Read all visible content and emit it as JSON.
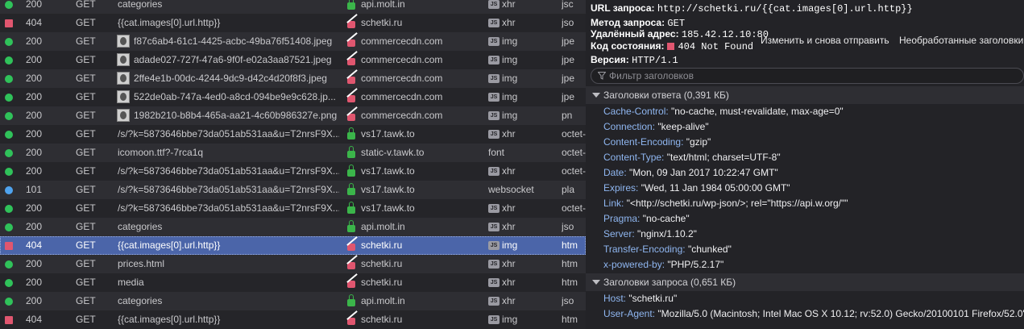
{
  "requests": [
    {
      "status": "200",
      "dot": "ok",
      "method": "GET",
      "file": "categories",
      "thumb": false,
      "domain": "api.molt.in",
      "secure": "lock",
      "js": true,
      "cause": "xhr",
      "type": "jsc"
    },
    {
      "status": "404",
      "dot": "err",
      "method": "GET",
      "file": "{{cat.images[0].url.http}}",
      "thumb": false,
      "domain": "schetki.ru",
      "secure": "insecure",
      "js": true,
      "cause": "xhr",
      "type": "jso"
    },
    {
      "status": "200",
      "dot": "ok",
      "method": "GET",
      "file": "f87c6ab4-61c1-4425-acbc-49ba76f51408.jpeg",
      "thumb": true,
      "domain": "commercecdn.com",
      "secure": "insecure",
      "js": true,
      "cause": "img",
      "type": "jpe"
    },
    {
      "status": "200",
      "dot": "ok",
      "method": "GET",
      "file": "adade027-727f-47a6-9f0f-e02a3aa87521.jpeg",
      "thumb": true,
      "domain": "commercecdn.com",
      "secure": "insecure",
      "js": true,
      "cause": "img",
      "type": "jpe"
    },
    {
      "status": "200",
      "dot": "ok",
      "method": "GET",
      "file": "2ffe4e1b-00dc-4244-9dc9-d42c4d20f8f3.jpeg",
      "thumb": true,
      "domain": "commercecdn.com",
      "secure": "insecure",
      "js": true,
      "cause": "img",
      "type": "jpe"
    },
    {
      "status": "200",
      "dot": "ok",
      "method": "GET",
      "file": "522de0ab-747a-4ed0-a8cd-094be9e9c628.jp...",
      "thumb": true,
      "domain": "commercecdn.com",
      "secure": "insecure",
      "js": true,
      "cause": "img",
      "type": "jpe"
    },
    {
      "status": "200",
      "dot": "ok",
      "method": "GET",
      "file": "1982b210-b8b4-465a-aa21-4c60b986327e.png",
      "thumb": true,
      "domain": "commercecdn.com",
      "secure": "insecure",
      "js": true,
      "cause": "img",
      "type": "pn"
    },
    {
      "status": "200",
      "dot": "ok",
      "method": "GET",
      "file": "/s/?k=5873646bbe73da051ab531aa&u=T2nrsF9X...",
      "thumb": false,
      "domain": "vs17.tawk.to",
      "secure": "lock",
      "js": true,
      "cause": "xhr",
      "type": "octet-"
    },
    {
      "status": "200",
      "dot": "ok",
      "method": "GET",
      "file": "icomoon.ttf?-7rca1q",
      "thumb": false,
      "domain": "static-v.tawk.to",
      "secure": "lock",
      "js": false,
      "cause": "font",
      "type": "octet-"
    },
    {
      "status": "200",
      "dot": "ok",
      "method": "GET",
      "file": "/s/?k=5873646bbe73da051ab531aa&u=T2nrsF9X...",
      "thumb": false,
      "domain": "vs17.tawk.to",
      "secure": "lock",
      "js": true,
      "cause": "xhr",
      "type": "octet-"
    },
    {
      "status": "101",
      "dot": "info",
      "method": "GET",
      "file": "/s/?k=5873646bbe73da051ab531aa&u=T2nrsF9X...",
      "thumb": false,
      "domain": "vs17.tawk.to",
      "secure": "lock",
      "js": false,
      "cause": "websocket",
      "type": "pla"
    },
    {
      "status": "200",
      "dot": "ok",
      "method": "GET",
      "file": "/s/?k=5873646bbe73da051ab531aa&u=T2nrsF9X...",
      "thumb": false,
      "domain": "vs17.tawk.to",
      "secure": "lock",
      "js": true,
      "cause": "xhr",
      "type": "octet-"
    },
    {
      "status": "200",
      "dot": "ok",
      "method": "GET",
      "file": "categories",
      "thumb": false,
      "domain": "api.molt.in",
      "secure": "lock",
      "js": true,
      "cause": "xhr",
      "type": "jso"
    },
    {
      "status": "404",
      "dot": "err",
      "method": "GET",
      "file": "{{cat.images[0].url.http}}",
      "thumb": false,
      "domain": "schetki.ru",
      "secure": "insecure",
      "js": true,
      "cause": "img",
      "type": "htm",
      "selected": true
    },
    {
      "status": "200",
      "dot": "ok",
      "method": "GET",
      "file": "prices.html",
      "thumb": false,
      "domain": "schetki.ru",
      "secure": "insecure",
      "js": true,
      "cause": "xhr",
      "type": "htm"
    },
    {
      "status": "200",
      "dot": "ok",
      "method": "GET",
      "file": "media",
      "thumb": false,
      "domain": "schetki.ru",
      "secure": "insecure",
      "js": true,
      "cause": "xhr",
      "type": "htm"
    },
    {
      "status": "200",
      "dot": "ok",
      "method": "GET",
      "file": "categories",
      "thumb": false,
      "domain": "api.molt.in",
      "secure": "lock",
      "js": true,
      "cause": "xhr",
      "type": "jso"
    },
    {
      "status": "404",
      "dot": "err",
      "method": "GET",
      "file": "{{cat.images[0].url.http}}",
      "thumb": false,
      "domain": "schetki.ru",
      "secure": "insecure",
      "js": true,
      "cause": "img",
      "type": "htm"
    }
  ],
  "summary": {
    "url_label": "URL запроса:",
    "url_value": "http://schetki.ru/{{cat.images[0].url.http}}",
    "method_label": "Метод запроса:",
    "method_value": "GET",
    "remote_label": "Удалённый адрес:",
    "remote_value": "185.42.12.10:80",
    "status_label": "Код состояния:",
    "status_value": "404 Not Found",
    "version_label": "Версия:",
    "version_value": "HTTP/1.1"
  },
  "buttons": {
    "resend": "Изменить и снова отправить",
    "raw": "Необработанные заголовки"
  },
  "filter": {
    "placeholder": "Фильтр заголовков"
  },
  "response_headers_title": "Заголовки ответа (0,391 КБ)",
  "response_headers": [
    {
      "name": "Cache-Control:",
      "value": "\"no-cache, must-revalidate, max-age=0\""
    },
    {
      "name": "Connection:",
      "value": "\"keep-alive\""
    },
    {
      "name": "Content-Encoding:",
      "value": "\"gzip\""
    },
    {
      "name": "Content-Type:",
      "value": "\"text/html; charset=UTF-8\""
    },
    {
      "name": "Date:",
      "value": "\"Mon, 09 Jan 2017 10:22:47 GMT\""
    },
    {
      "name": "Expires:",
      "value": "\"Wed, 11 Jan 1984 05:00:00 GMT\""
    },
    {
      "name": "Link:",
      "value": "\"<http://schetki.ru/wp-json/>; rel=\"https://api.w.org/\"\""
    },
    {
      "name": "Pragma:",
      "value": "\"no-cache\""
    },
    {
      "name": "Server:",
      "value": "\"nginx/1.10.2\""
    },
    {
      "name": "Transfer-Encoding:",
      "value": "\"chunked\""
    },
    {
      "name": "x-powered-by:",
      "value": "\"PHP/5.2.17\""
    }
  ],
  "request_headers_title": "Заголовки запроса (0,651 КБ)",
  "request_headers": [
    {
      "name": "Host:",
      "value": "\"schetki.ru\""
    },
    {
      "name": "User-Agent:",
      "value": "\"Mozilla/5.0 (Macintosh; Intel Mac OS X 10.12; rv:52.0) Gecko/20100101 Firefox/52.0\""
    }
  ],
  "js_badge": "JS"
}
